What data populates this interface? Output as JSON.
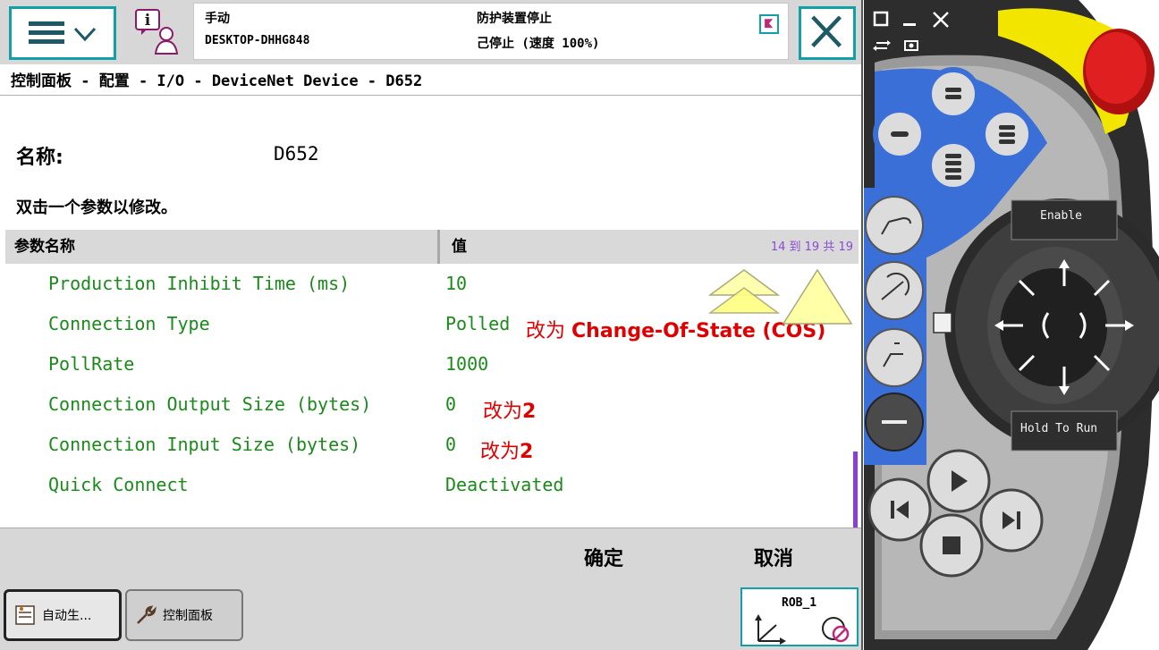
{
  "header": {
    "mode": "手动",
    "host": "DESKTOP-DHHG848",
    "safety_status": "防护装置停止",
    "run_status": "己停止 (速度 100%)"
  },
  "breadcrumb": "控制面板 - 配置 - I/O - DeviceNet Device - D652",
  "name_label": "名称:",
  "name_value": "D652",
  "hint": "双击一个参数以修改。",
  "table": {
    "col_name": "参数名称",
    "col_value": "值",
    "page_counter": "14 到 19 共 19",
    "rows": [
      {
        "name": "Production Inhibit Time (ms)",
        "value": "10"
      },
      {
        "name": "Connection Type",
        "value": "Polled"
      },
      {
        "name": "PollRate",
        "value": "1000"
      },
      {
        "name": "Connection Output Size (bytes)",
        "value": "0"
      },
      {
        "name": "Connection Input Size (bytes)",
        "value": "0"
      },
      {
        "name": "Quick Connect",
        "value": "Deactivated"
      }
    ]
  },
  "annotations": {
    "connection_type_prefix": "改为",
    "connection_type_target": "Change-Of-State (COS)",
    "output_size_prefix": "改为",
    "output_size_target": "2",
    "input_size_prefix": "改为",
    "input_size_target": "2"
  },
  "actions": {
    "ok": "确定",
    "cancel": "取消"
  },
  "taskbar": {
    "auto": "自动生...",
    "control_panel": "控制面板",
    "robot": "ROB_1"
  },
  "pendant": {
    "enable": "Enable",
    "hold_to_run": "Hold To Run"
  },
  "colors": {
    "accent": "#11a0a7",
    "param_text": "#1a8a1a",
    "annotation": "#e00000",
    "page_counter": "#8a4ad6",
    "pendant_blue": "#3b6fd8",
    "emergency_red": "#e02020",
    "guard_yellow": "#f2e600"
  }
}
